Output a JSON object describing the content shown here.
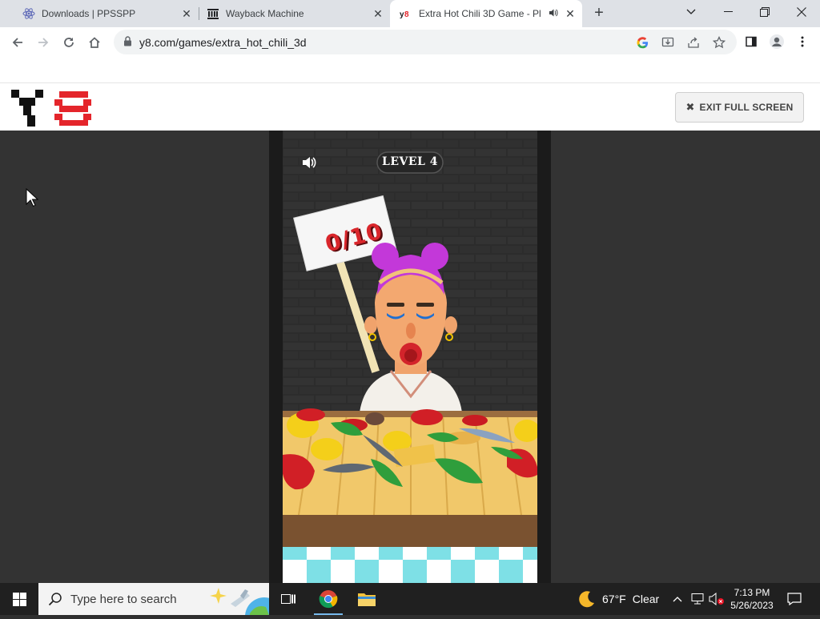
{
  "browser": {
    "tabs": [
      {
        "title": "Downloads | PPSSPP",
        "active": false
      },
      {
        "title": "Wayback Machine",
        "active": false
      },
      {
        "title": "Extra Hot Chili 3D Game - Pl",
        "active": true
      }
    ],
    "address": "y8.com/games/extra_hot_chili_3d"
  },
  "site": {
    "exit_fullscreen_label": "EXIT FULL SCREEN"
  },
  "game": {
    "level_label": "LEVEL 4",
    "sign_text": "0/10"
  },
  "taskbar": {
    "search_placeholder": "Type here to search",
    "weather_temp": "67°F",
    "weather_desc": "Clear",
    "time": "7:13 PM",
    "date": "5/26/2023"
  },
  "colors": {
    "accent_blue": "#1a73e8",
    "y8_red": "#e4252b",
    "hair_magenta": "#c338d9",
    "table_wood": "#f1c86a"
  }
}
